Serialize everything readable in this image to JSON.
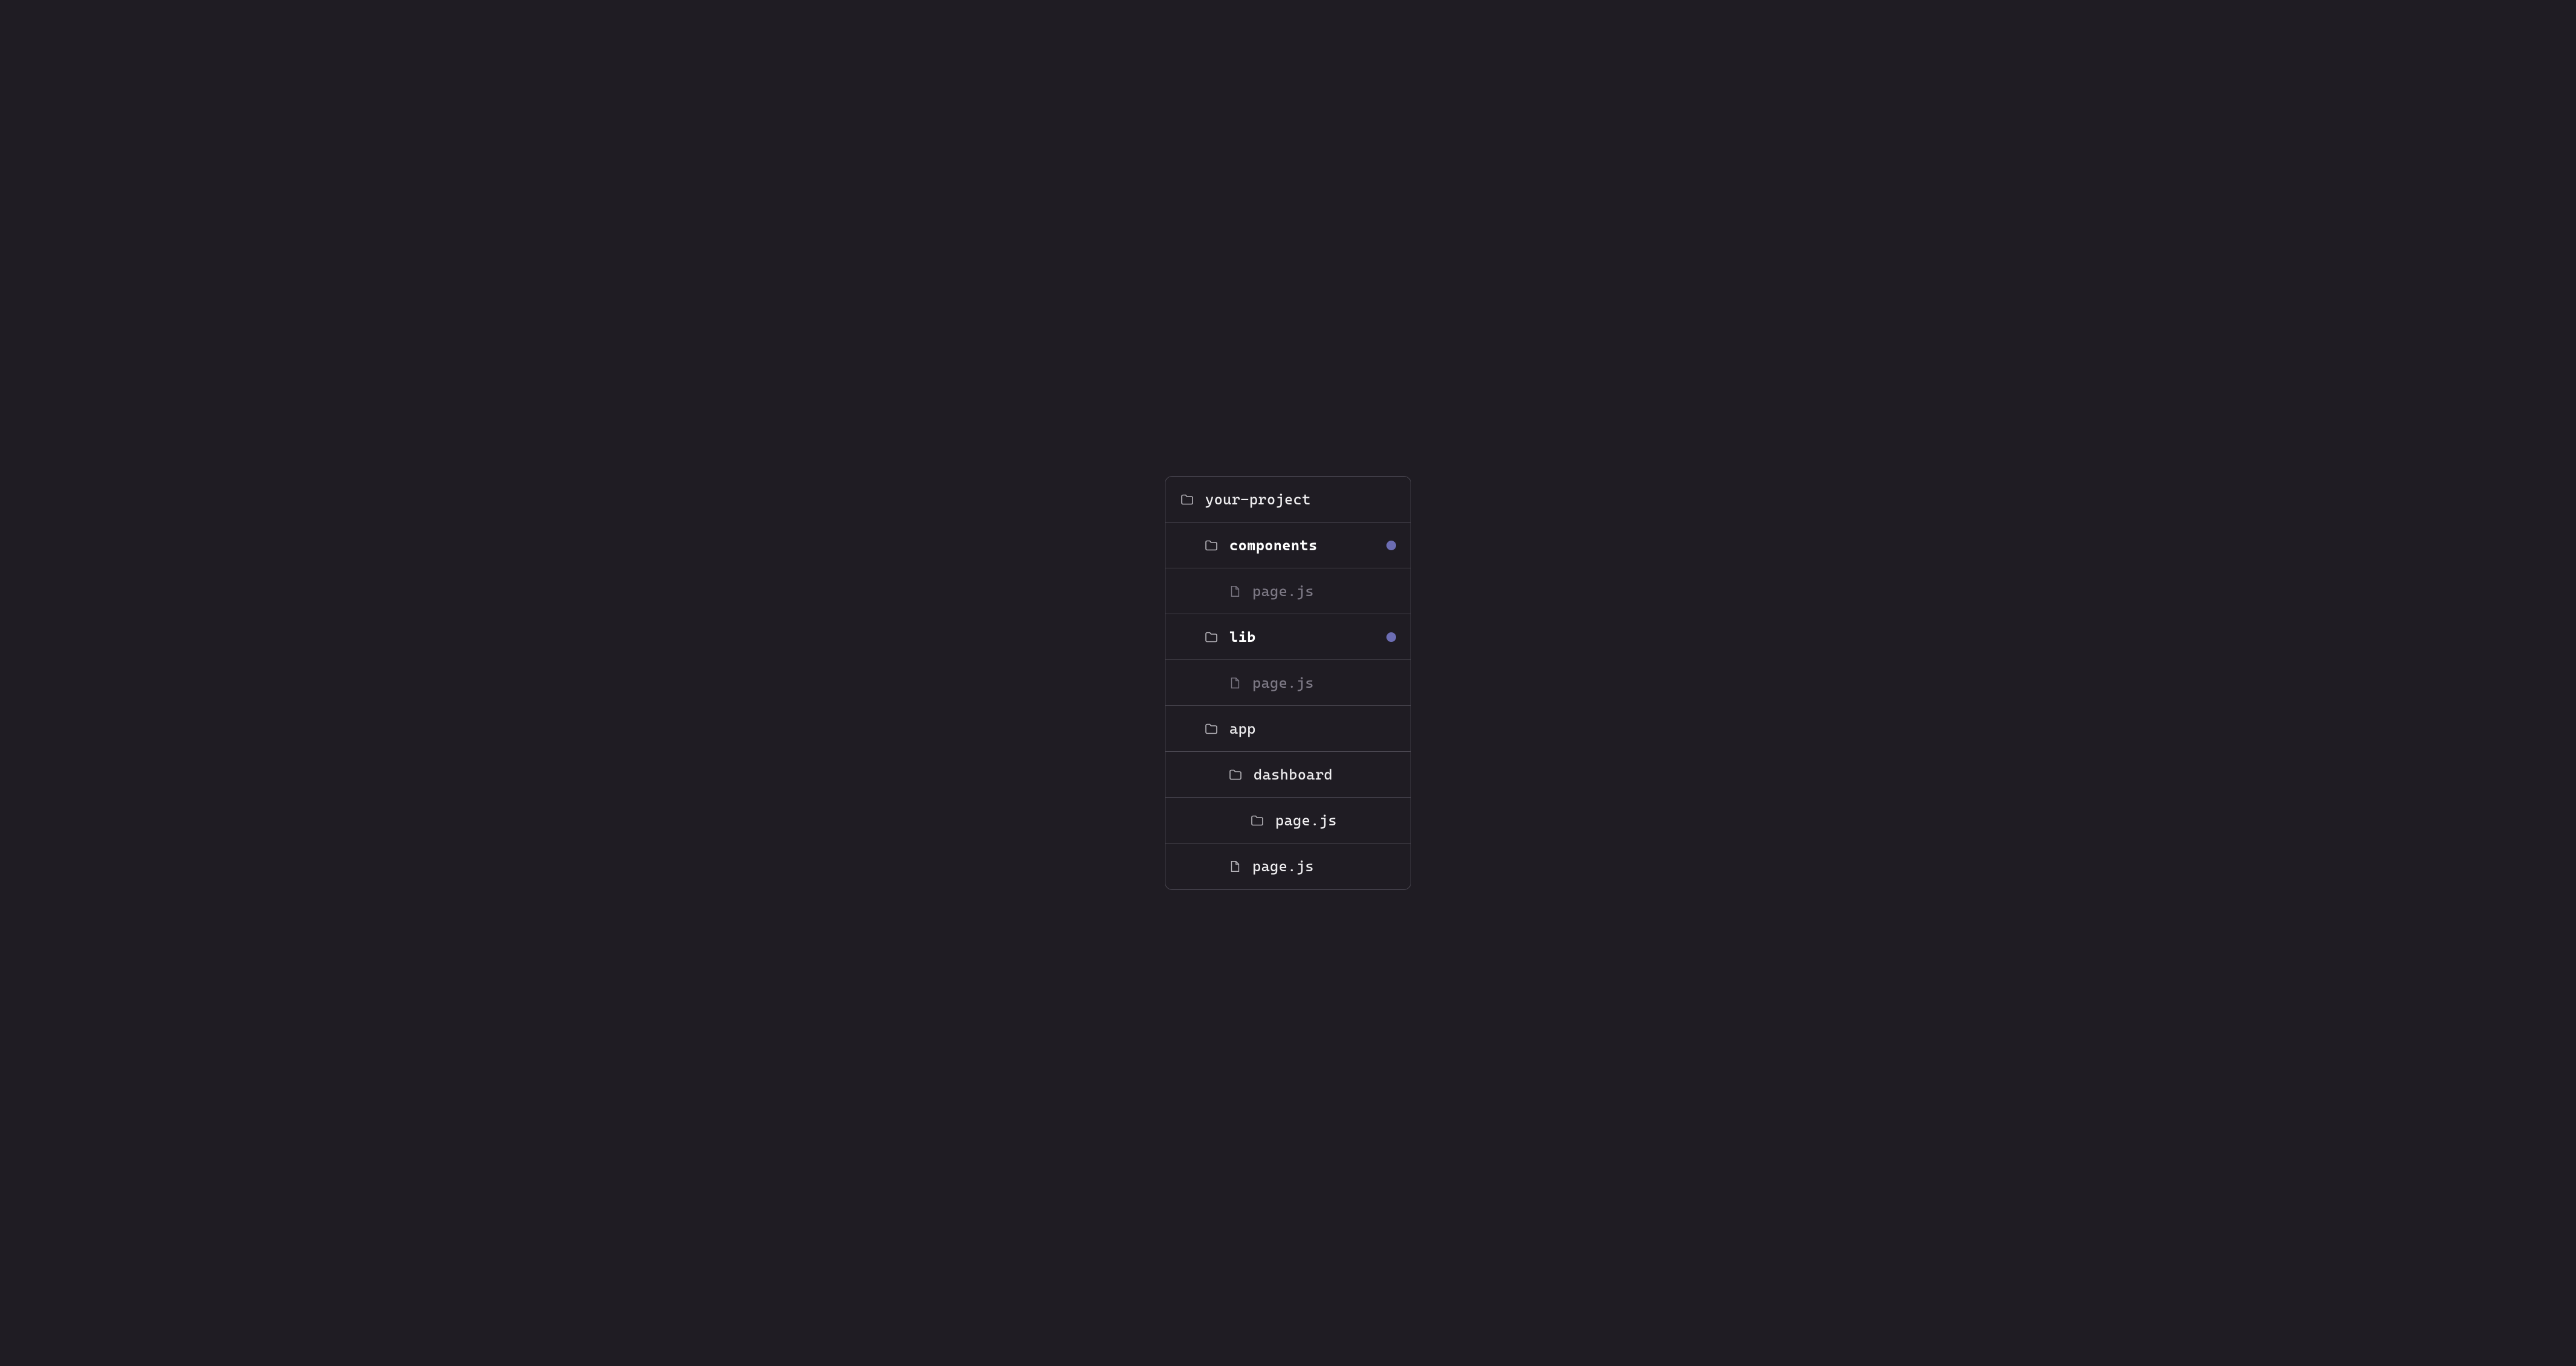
{
  "colors": {
    "background": "#1f1c23",
    "border": "#4a4751",
    "text": "#eeedef",
    "text_bold": "#ffffff",
    "text_dim": "#7c7884",
    "dot": "#6c6db3"
  },
  "tree": {
    "root": {
      "label": "your-project",
      "type": "folder"
    },
    "items": [
      {
        "label": "components",
        "type": "folder",
        "indent": 1,
        "bold": true,
        "dot": true
      },
      {
        "label": "page.js",
        "type": "file",
        "indent": 2,
        "dim": true
      },
      {
        "label": "lib",
        "type": "folder",
        "indent": 1,
        "bold": true,
        "dot": true
      },
      {
        "label": "page.js",
        "type": "file",
        "indent": 2,
        "dim": true
      },
      {
        "label": "app",
        "type": "folder",
        "indent": 1
      },
      {
        "label": "dashboard",
        "type": "folder",
        "indent": 2
      },
      {
        "label": "page.js",
        "type": "folder",
        "indent": 3
      },
      {
        "label": "page.js",
        "type": "file",
        "indent": 2
      }
    ]
  }
}
